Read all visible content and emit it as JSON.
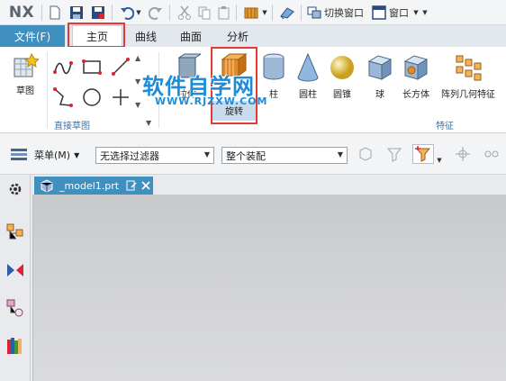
{
  "app": {
    "logo": "NX"
  },
  "quick_access": {
    "switch_window": "切换窗口",
    "window_menu": "窗口",
    "dropdown_glyph": "▼"
  },
  "tabs": {
    "file": "文件(F)",
    "items": [
      "主页",
      "曲线",
      "曲面",
      "分析"
    ],
    "active": "主页"
  },
  "ribbon": {
    "sketch": "草图",
    "direct_sketch_group": "直接草图",
    "features_group": "特征",
    "feature_items": [
      "圆柱",
      "圆锥",
      "球",
      "长方体",
      "孔",
      "阵列几何特征"
    ],
    "partial_labels": [
      "拉伸",
      "旋转",
      "柱"
    ]
  },
  "watermark": {
    "main": "软件自学网",
    "sub": "WWW.RJZXW.COM"
  },
  "selection_bar": {
    "menu": "菜单(M)",
    "filter": "无选择过滤器",
    "scope": "整个装配"
  },
  "document": {
    "tab_name": "_model1.prt"
  },
  "colors": {
    "accent": "#3f8fbf",
    "highlight": "#e53935",
    "watermark": "#1e8bd8"
  }
}
